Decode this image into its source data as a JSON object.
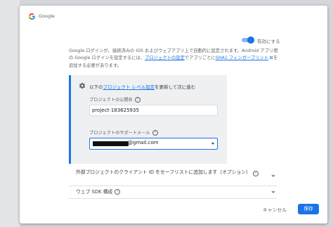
{
  "dialog": {
    "title": "Google",
    "toggle_label": "有効にする",
    "toggle_on": true,
    "desc_part1": "Google ログインが、接続済みの iOS およびウェブアプリ上で自動的に設定されます。Android アプリ用の Google ログインを設定するには、",
    "desc_link1": "プロジェクトの設定",
    "desc_part2": "でアプリごとに",
    "desc_link2": "SHA1 フィンガープリント",
    "desc_part3": "を追加する必要があります。"
  },
  "panel": {
    "step_prefix": "以下の",
    "step_link": "プロジェクト レベル設定",
    "step_suffix": "を更新して次に進む",
    "public_name_label": "プロジェクトの公開名",
    "public_name_value": "project-183625935",
    "support_email_label": "プロジェクトのサポートメール",
    "support_email_value": "@gmail.com"
  },
  "sections": [
    {
      "label": "外部プロジェクトのクライアント ID をセーフリストに追加します（オプション）"
    },
    {
      "label": "ウェブ SDK 構成"
    }
  ],
  "actions": {
    "cancel": "キャンセル",
    "save": "保存"
  },
  "icons": {
    "logo": "google-g-icon",
    "gear": "gear-icon",
    "help": "help-icon",
    "chevron": "chevron-down-icon",
    "external": "open-in-new-icon"
  },
  "colors": {
    "accent": "#1a73e8",
    "panel_bg": "#eef0f2"
  }
}
